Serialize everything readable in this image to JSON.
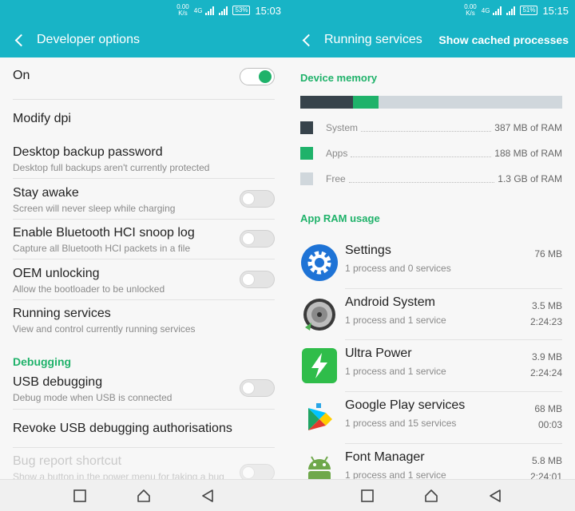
{
  "status_left": {
    "speed_value": "0.00",
    "speed_unit": "K/s",
    "network": "4G",
    "battery": "53%",
    "time": "15:03"
  },
  "status_right": {
    "speed_value": "0.00",
    "speed_unit": "K/s",
    "network": "4G",
    "battery": "51%",
    "time": "15:15"
  },
  "left": {
    "title": "Developer options",
    "master": {
      "label": "On",
      "checked": true
    },
    "items": [
      {
        "title": "Modify dpi",
        "subtitle": ""
      },
      {
        "title": "Desktop backup password",
        "subtitle": "Desktop full backups aren't currently protected"
      },
      {
        "title": "Stay awake",
        "subtitle": "Screen will never sleep while charging",
        "toggle": false
      },
      {
        "title": "Enable Bluetooth HCI snoop log",
        "subtitle": "Capture all Bluetooth HCI packets in a file",
        "toggle": false
      },
      {
        "title": "OEM unlocking",
        "subtitle": "Allow the bootloader to be unlocked",
        "toggle": false
      },
      {
        "title": "Running services",
        "subtitle": "View and control currently running services"
      }
    ],
    "debugging_header": "Debugging",
    "debug_items": [
      {
        "title": "USB debugging",
        "subtitle": "Debug mode when USB is connected",
        "toggle": false
      },
      {
        "title": "Revoke USB debugging authorisations",
        "subtitle": ""
      },
      {
        "title": "Bug report shortcut",
        "subtitle": "Show a button in the power menu for taking a bug",
        "toggle": false,
        "disabled": true
      }
    ]
  },
  "right": {
    "title": "Running services",
    "action": "Show cached processes",
    "device_memory_header": "Device memory",
    "memory_bar": {
      "system_fraction": 0.2,
      "apps_fraction": 0.1
    },
    "memory": [
      {
        "label": "System",
        "value": "387 MB of RAM",
        "color": "#37434b"
      },
      {
        "label": "Apps",
        "value": "188 MB of RAM",
        "color": "#1fb26a"
      },
      {
        "label": "Free",
        "value": "1.3 GB of RAM",
        "color": "#d0d7dc"
      }
    ],
    "app_ram_header": "App RAM usage",
    "apps": [
      {
        "name": "Settings",
        "desc": "1 process and 0 services",
        "size": "76 MB",
        "time": "",
        "icon": "settings-gear-icon"
      },
      {
        "name": "Android System",
        "desc": "1 process and 1 service",
        "size": "3.5 MB",
        "time": "2:24:23",
        "icon": "android-system-icon"
      },
      {
        "name": "Ultra Power",
        "desc": "1 process and 1 service",
        "size": "3.9 MB",
        "time": "2:24:24",
        "icon": "ultra-power-icon"
      },
      {
        "name": "Google Play services",
        "desc": "1 process and 15 services",
        "size": "68 MB",
        "time": "00:03",
        "icon": "google-play-services-icon"
      },
      {
        "name": "Font Manager",
        "desc": "1 process and 1 service",
        "size": "5.8 MB",
        "time": "2:24:01",
        "icon": "android-robot-icon"
      }
    ]
  },
  "colors": {
    "header": "#18b4c6",
    "accent": "#1fb26a"
  }
}
